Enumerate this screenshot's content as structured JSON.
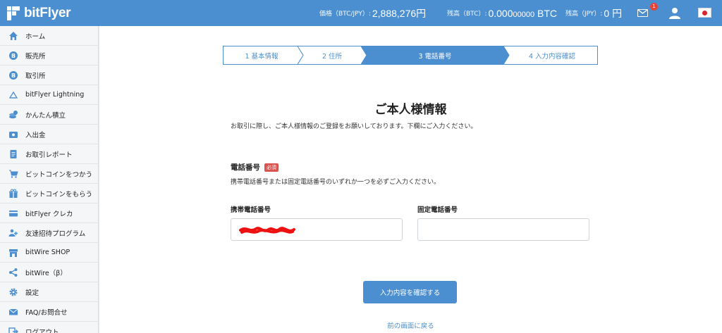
{
  "header": {
    "brand": "bitFlyer",
    "price_label": "価格（BTC/JPY）:",
    "price_value": "2,888,276円",
    "btc_label": "残高（BTC）:",
    "btc_value_main": "0.000",
    "btc_value_small": "00000",
    "btc_unit": "BTC",
    "jpy_label": "残高（JPY）:",
    "jpy_value": "0 円",
    "mail_badge": "1",
    "brand_color": "#4b8fd0"
  },
  "sidebar": {
    "items": [
      {
        "label": "ホーム",
        "icon": "home-icon"
      },
      {
        "label": "販売所",
        "icon": "bitcoin-icon"
      },
      {
        "label": "取引所",
        "icon": "bitcoin-icon"
      },
      {
        "label": "bitFlyer Lightning",
        "icon": "lightning-icon"
      },
      {
        "label": "かんたん積立",
        "icon": "coins-icon"
      },
      {
        "label": "入出金",
        "icon": "wallet-icon"
      },
      {
        "label": "お取引レポート",
        "icon": "report-icon"
      },
      {
        "label": "ビットコインをつかう",
        "icon": "cart-icon"
      },
      {
        "label": "ビットコインをもらう",
        "icon": "gift-icon"
      },
      {
        "label": "bitFlyer クレカ",
        "icon": "credit-card-icon"
      },
      {
        "label": "友達招待プログラム",
        "icon": "invite-icon"
      },
      {
        "label": "bitWire SHOP",
        "icon": "shop-icon"
      },
      {
        "label": "bitWire（β）",
        "icon": "share-icon"
      },
      {
        "label": "設定",
        "icon": "gear-icon"
      },
      {
        "label": "FAQ/お問合せ",
        "icon": "mail-icon"
      },
      {
        "label": "ログアウト",
        "icon": "logout-icon"
      }
    ]
  },
  "steps": [
    {
      "label": "1 基本情報",
      "active": false
    },
    {
      "label": "2 住所",
      "active": false
    },
    {
      "label": "3 電話番号",
      "active": true
    },
    {
      "label": "4 入力内容確認",
      "active": false
    }
  ],
  "main": {
    "title": "ご本人様情報",
    "intro": "お取引に際し、ご本人様情報のご登録をお願いしております。下欄にご入力ください。",
    "section_label": "電話番号",
    "required_badge": "必須",
    "section_note": "携帯電話番号または固定電話番号のいずれか一つを必ずご入力ください。",
    "mobile_label": "携帯電話番号",
    "mobile_value": "",
    "landline_label": "固定電話番号",
    "landline_value": "",
    "submit_label": "入力内容を確認する",
    "back_label": "前の画面に戻る"
  }
}
